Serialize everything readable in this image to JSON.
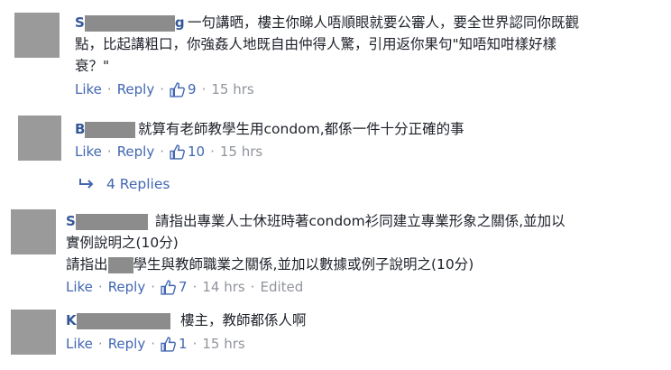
{
  "comments": [
    {
      "name": "S",
      "name_tail": "g",
      "lines": [
        "一句講晒，樓主你睇人唔順眼就要公審人，要全世界認同你既觀",
        "點，比起講粗口，你強姦人地既自由仲得人驚，引用返你果句\"知唔知咁樣好樣",
        "衰？\""
      ],
      "like": "Like",
      "reply": "Reply",
      "count": "9",
      "time": "15 hrs"
    },
    {
      "name": "B",
      "lines": [
        "就算有老師教學生用condom,都係一件十分正確的事"
      ],
      "like": "Like",
      "reply": "Reply",
      "count": "10",
      "time": "15 hrs"
    },
    {
      "name": "S",
      "lines": [
        "請指出專業人士休班時著condom衫同建立專業形象之關係,並加以",
        "實例說明之(10分)",
        "請指出",
        "學生與教師職業之關係,並加以數據或例子說明之(10分)"
      ],
      "like": "Like",
      "reply": "Reply",
      "count": "7",
      "time": "14 hrs",
      "edited": "Edited"
    },
    {
      "name": "K",
      "lines": [
        "樓主，教師都係人啊"
      ],
      "like": "Like",
      "reply": "Reply",
      "count": "1",
      "time": "15 hrs"
    }
  ],
  "replies_link": "4 Replies",
  "colors": {
    "link": "#4267b2",
    "meta": "#90949c",
    "name": "#365899"
  }
}
